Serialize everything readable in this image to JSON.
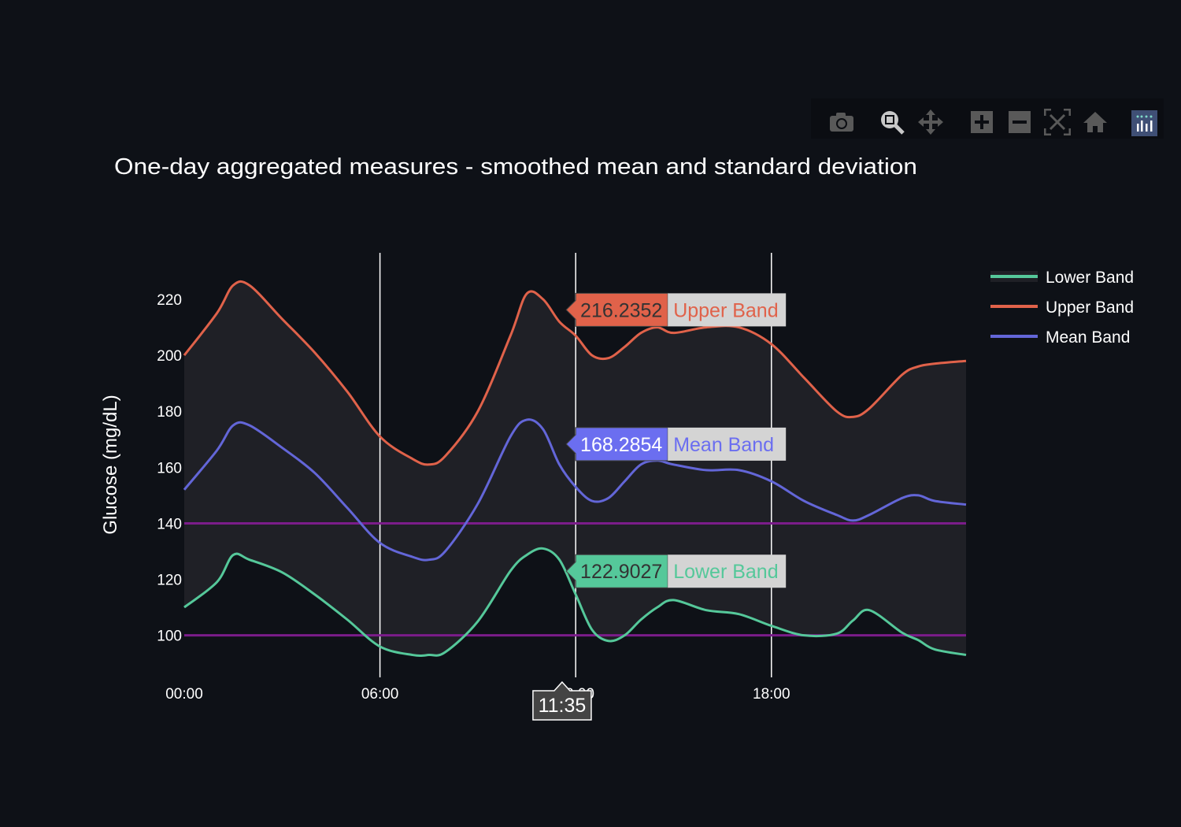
{
  "chart_data": {
    "type": "line",
    "title": "One-day aggregated measures - smoothed mean and standard deviation",
    "xlabel": "",
    "ylabel": "Glucose (mg/dL)",
    "x_tick_labels": [
      "00:00",
      "06:00",
      "12:00",
      "18:00"
    ],
    "y_tick_labels": [
      "100",
      "120",
      "140",
      "160",
      "180",
      "200",
      "220"
    ],
    "ylim": [
      85,
      236.6
    ],
    "xlim": [
      "00:00",
      "23:58"
    ],
    "grid": {
      "x": true,
      "y": false
    },
    "reference_lines": [
      {
        "y": 100,
        "color": "#7b1c8a"
      },
      {
        "y": 140,
        "color": "#7b1c8a"
      }
    ],
    "legend_placement": "top-right",
    "fill_between": {
      "from": "Lower Band",
      "to": "Upper Band",
      "color": "#1f2026"
    },
    "x": [
      "00:00",
      "01:00",
      "01:30",
      "02:00",
      "03:00",
      "04:00",
      "05:00",
      "06:00",
      "07:00",
      "07:30",
      "08:00",
      "09:00",
      "10:00",
      "10:30",
      "11:00",
      "11:30",
      "12:00",
      "12:30",
      "13:00",
      "13:30",
      "14:00",
      "14:30",
      "15:00",
      "16:00",
      "17:00",
      "18:00",
      "19:00",
      "20:00",
      "20:30",
      "21:00",
      "22:00",
      "22:30",
      "23:00",
      "23:58"
    ],
    "series": [
      {
        "name": "Lower Band",
        "color": "#55c89a",
        "values": [
          110,
          119,
          128.7,
          127,
          122.5,
          114.6,
          105.6,
          96,
          93,
          93,
          94,
          105,
          123,
          128.7,
          131,
          127,
          114.6,
          102,
          98,
          100,
          105.6,
          110,
          112.6,
          109,
          107.6,
          103.4,
          100,
          100.6,
          105.3,
          109,
          101,
          98.3,
          95,
          93
        ]
      },
      {
        "name": "Upper Band",
        "color": "#e0624a",
        "values": [
          200,
          215,
          225,
          225,
          213,
          201,
          187,
          171,
          163,
          161,
          164,
          180,
          207,
          222,
          220,
          212,
          207,
          200,
          199,
          203,
          208,
          210,
          208,
          210,
          210,
          204,
          192,
          180,
          178,
          181,
          193,
          196,
          197,
          198
        ]
      },
      {
        "name": "Mean Band",
        "color": "#6366d8",
        "values": [
          152,
          166,
          175,
          175,
          167,
          158,
          145.5,
          133,
          128,
          127,
          130,
          147,
          171,
          177,
          173.6,
          161,
          153,
          148,
          149,
          155,
          161,
          162.4,
          161,
          159,
          159,
          155,
          148,
          143,
          141,
          143,
          149,
          150,
          148,
          146.7
        ]
      }
    ],
    "hover": {
      "x_label": "11:35",
      "items": [
        {
          "value": "216.2352",
          "name": "Upper Band",
          "y": 216.2352,
          "color": "#e0624a"
        },
        {
          "value": "168.2854",
          "name": "Mean Band",
          "y": 168.2854,
          "color": "#6b6ef0"
        },
        {
          "value": "122.9027",
          "name": "Lower Band",
          "y": 122.9027,
          "color": "#55c89a"
        }
      ]
    }
  },
  "modebar": {
    "icons": [
      "camera-icon",
      "zoom-icon",
      "pan-icon",
      "zoom-in-icon",
      "zoom-out-icon",
      "autoscale-icon",
      "reset-axes-icon",
      "plotly-logo-icon"
    ]
  }
}
